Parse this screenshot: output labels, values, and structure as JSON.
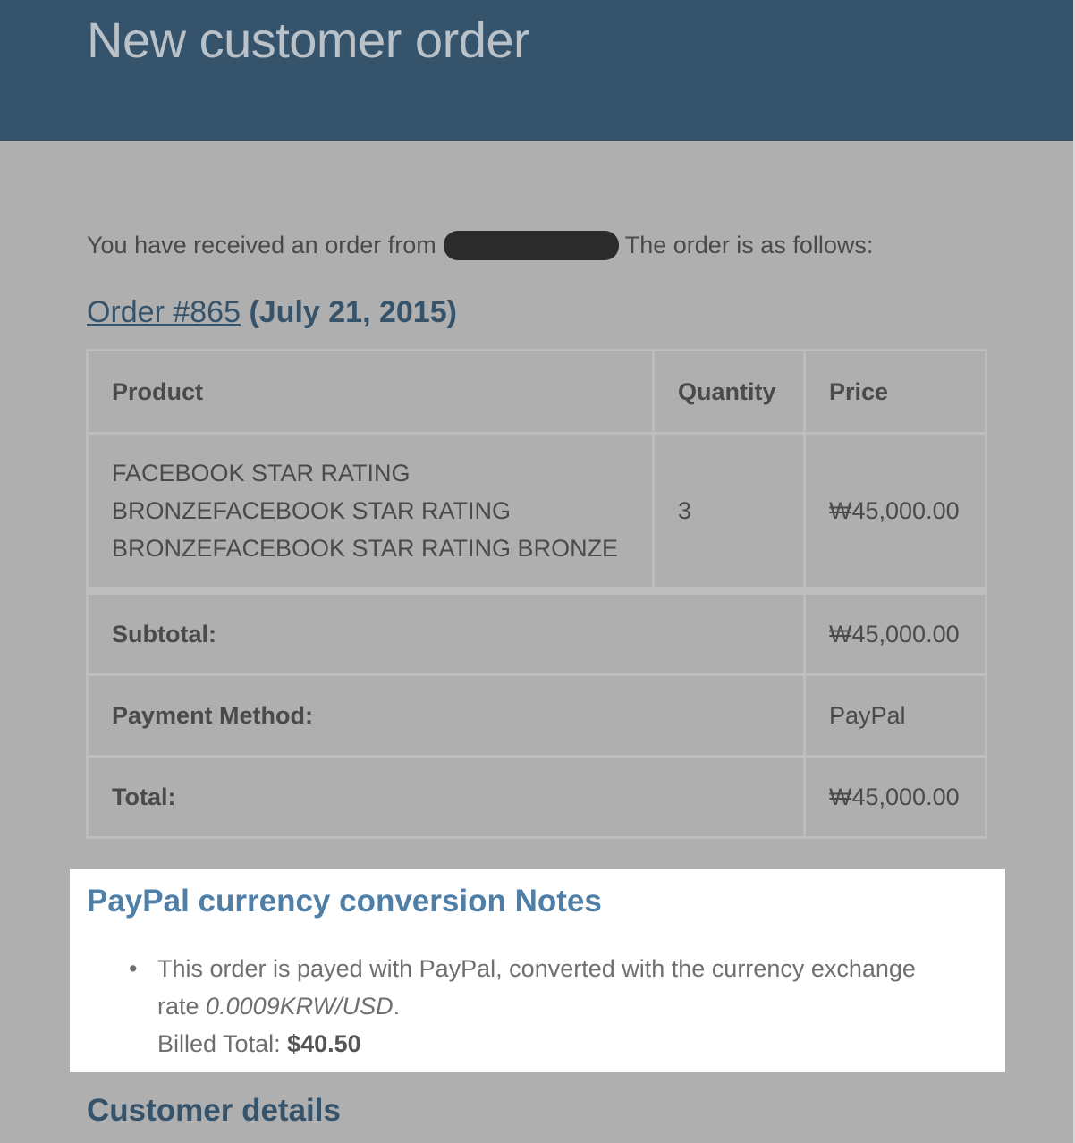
{
  "header": {
    "title": "New customer order",
    "background_color": "#36536c"
  },
  "intro": {
    "prefix": "You have received an order from",
    "suffix": "The order is as follows:"
  },
  "order": {
    "link_text": "Order #865",
    "date": "(July 21, 2015)"
  },
  "table": {
    "headers": [
      "Product",
      "Quantity",
      "Price"
    ],
    "item": {
      "product_lines": [
        "FACEBOOK STAR RATING",
        "BRONZEFACEBOOK STAR RATING",
        "BRONZEFACEBOOK STAR RATING BRONZE"
      ],
      "quantity": "3",
      "price": "₩45,000.00"
    },
    "totals": [
      {
        "label": "Subtotal:",
        "value": "₩45,000.00"
      },
      {
        "label": "Payment Method:",
        "value": "PayPal"
      },
      {
        "label": "Total:",
        "value": "₩45,000.00"
      }
    ]
  },
  "notes": {
    "title": "PayPal currency conversion Notes",
    "bullet": "•",
    "line_text": "This order is payed with PayPal, converted with the currency exchange rate",
    "rate": "0.0009KRW/USD",
    "period": ".",
    "billed_label": "Billed Total:",
    "billed_amount": "$40.50",
    "accent_color": "#4f7fa6"
  },
  "customer_details": {
    "title": "Customer details"
  }
}
